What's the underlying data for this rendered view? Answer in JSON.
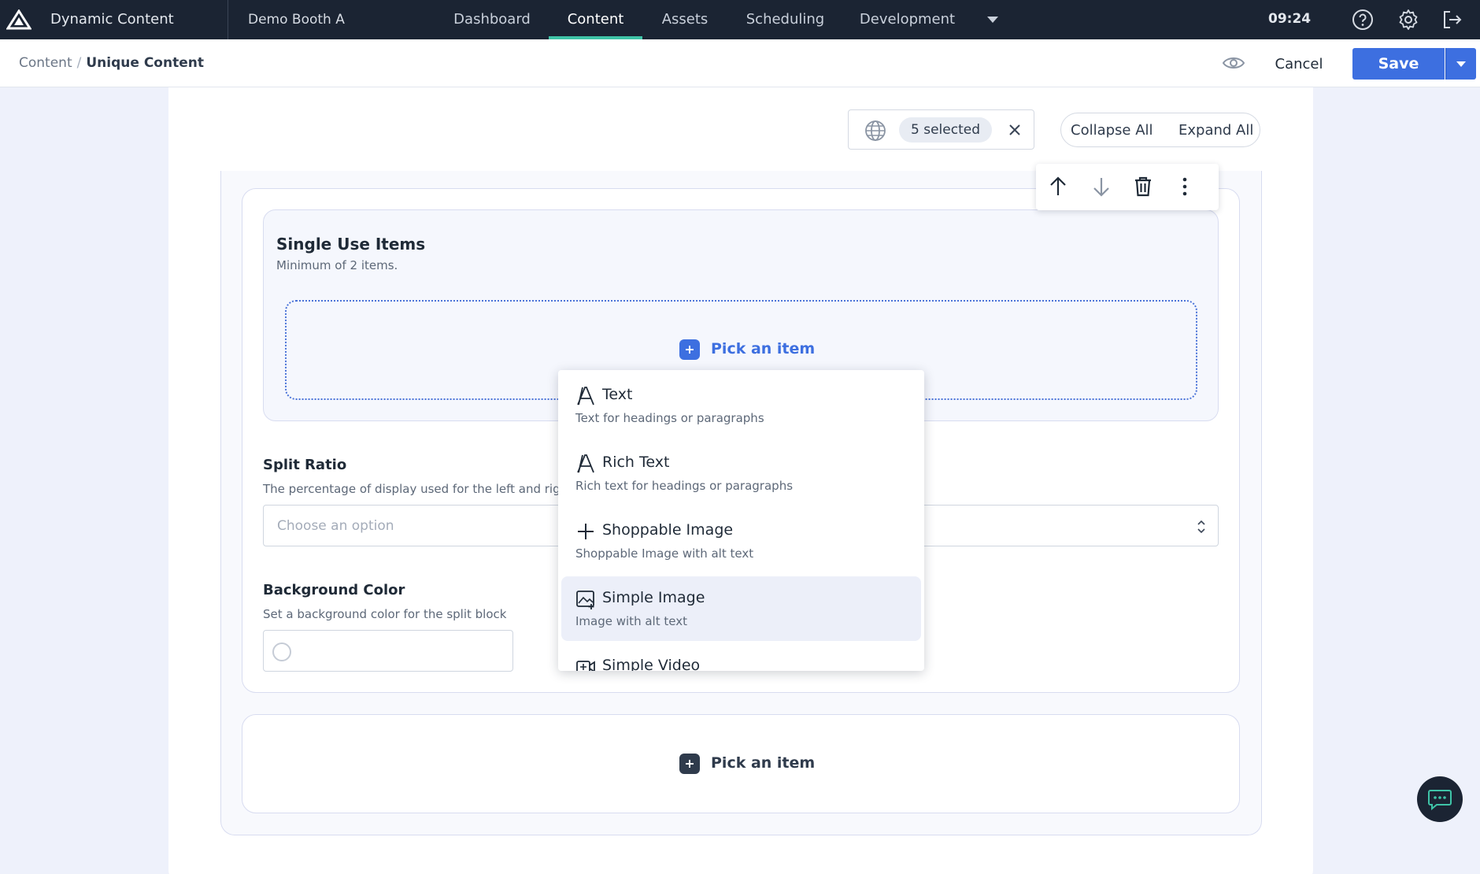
{
  "topbar": {
    "app_name": "Dynamic Content",
    "hub_name": "Demo Booth A",
    "tabs": [
      {
        "label": "Dashboard"
      },
      {
        "label": "Content"
      },
      {
        "label": "Assets"
      },
      {
        "label": "Scheduling"
      },
      {
        "label": "Development"
      }
    ],
    "active_tab": "Content",
    "time": "09:24",
    "accent_color": "#3fc3a7",
    "background_color": "#1b2433"
  },
  "toolbar": {
    "breadcrumb": {
      "parent": "Content",
      "separator": "/",
      "current": "Unique Content"
    },
    "cancel_label": "Cancel",
    "save_label": "Save",
    "primary_color": "#3d6fe0"
  },
  "locale_filter": {
    "selected_label": "5 selected"
  },
  "view_controls": {
    "collapse_label": "Collapse All",
    "expand_label": "Expand All"
  },
  "single_use_items": {
    "title": "Single Use Items",
    "help": "Minimum of 2 items.",
    "pick_label": "Pick an item"
  },
  "split_ratio": {
    "title": "Split Ratio",
    "help": "The percentage of display used for the left and right c",
    "placeholder": "Choose an option"
  },
  "background_color": {
    "title": "Background Color",
    "help": "Set a background color for the split block"
  },
  "bottom_picker": {
    "pick_label": "Pick an item"
  },
  "item_menu": {
    "options": [
      {
        "label": "Text",
        "description": "Text for headings or paragraphs",
        "icon": "text-icon"
      },
      {
        "label": "Rich Text",
        "description": "Rich text for headings or paragraphs",
        "icon": "rich-text-icon"
      },
      {
        "label": "Shoppable Image",
        "description": "Shoppable Image with alt text",
        "icon": "plus-icon"
      },
      {
        "label": "Simple Image",
        "description": "Image with alt text",
        "icon": "image-icon"
      },
      {
        "label": "Simple Video",
        "description": "",
        "icon": "video-icon"
      }
    ],
    "highlighted": "Simple Image"
  }
}
